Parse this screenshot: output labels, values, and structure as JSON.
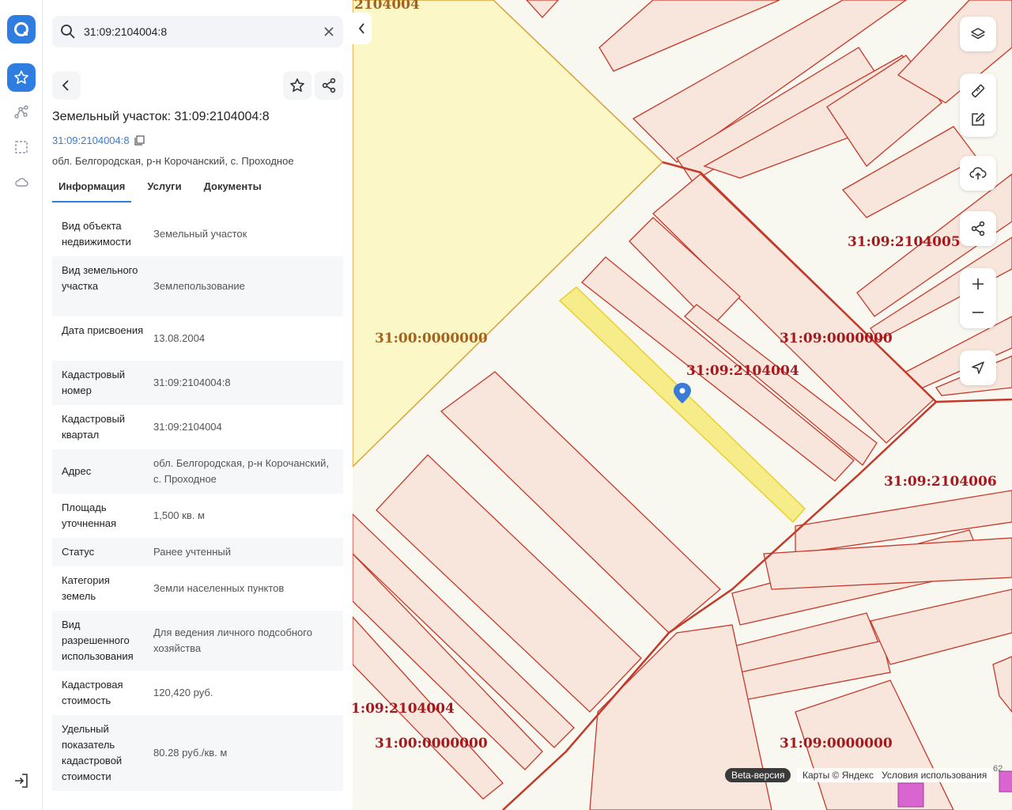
{
  "search": {
    "value": "31:09:2104004:8"
  },
  "object": {
    "title": "Земельный участок: 31:09:2104004:8",
    "cad_link": "31:09:2104004:8",
    "address": "обл. Белгородская, р-н Корочанский, с. Проходное"
  },
  "tabs": [
    {
      "label": "Информация"
    },
    {
      "label": "Услуги"
    },
    {
      "label": "Документы"
    }
  ],
  "info_rows": [
    {
      "key": "Вид объекта недвижимости",
      "value": "Земельный участок"
    },
    {
      "key": "Вид земельного участка",
      "value": "Землепользование"
    },
    {
      "key": "Дата присвоения",
      "value": "13.08.2004"
    },
    {
      "key": "Кадастровый номер",
      "value": "31:09:2104004:8"
    },
    {
      "key": "Кадастровый квартал",
      "value": "31:09:2104004"
    },
    {
      "key": "Адрес",
      "value": "обл. Белгородская, р-н Корочанский, с. Проходное"
    },
    {
      "key": "Площадь уточненная",
      "value": "1,500 кв. м"
    },
    {
      "key": "Статус",
      "value": "Ранее учтенный"
    },
    {
      "key": "Категория земель",
      "value": "Земли населенных пунктов"
    },
    {
      "key": "Вид разрешенного использования",
      "value": "Для ведения личного подсобного хозяйства"
    },
    {
      "key": "Кадастровая стоимость",
      "value": "120,420 руб."
    },
    {
      "key": "Удельный показатель кадастровой стоимости",
      "value": "80.28 руб./кв. м"
    }
  ],
  "map": {
    "labels": {
      "top_cut": "2104004",
      "block_2104005": "31:09:2104005",
      "zone_a": "31:00:0000000",
      "zone_b": "31:09:0000000",
      "block_current": "31:09:2104004",
      "block_2104006": "31:09:2104006",
      "bottom_cut": "1:09:2104004",
      "zone_a_bottom": "31:00:0000000",
      "zone_b_bottom": "31:09:0000000"
    },
    "beta_badge": "Beta-версия",
    "attribution": "Карты © Яндекс",
    "terms_link": "Условия использования",
    "zoom_readout": "62"
  },
  "colors": {
    "accent": "#2f7de1",
    "parcel_fill": "#f8e6dc",
    "parcel_stroke": "#c8382a",
    "selected_parcel": "#f7ec8a",
    "yellow_zone": "#fbf7c7",
    "label_red": "#a8171b",
    "label_brown": "#a5621d"
  }
}
